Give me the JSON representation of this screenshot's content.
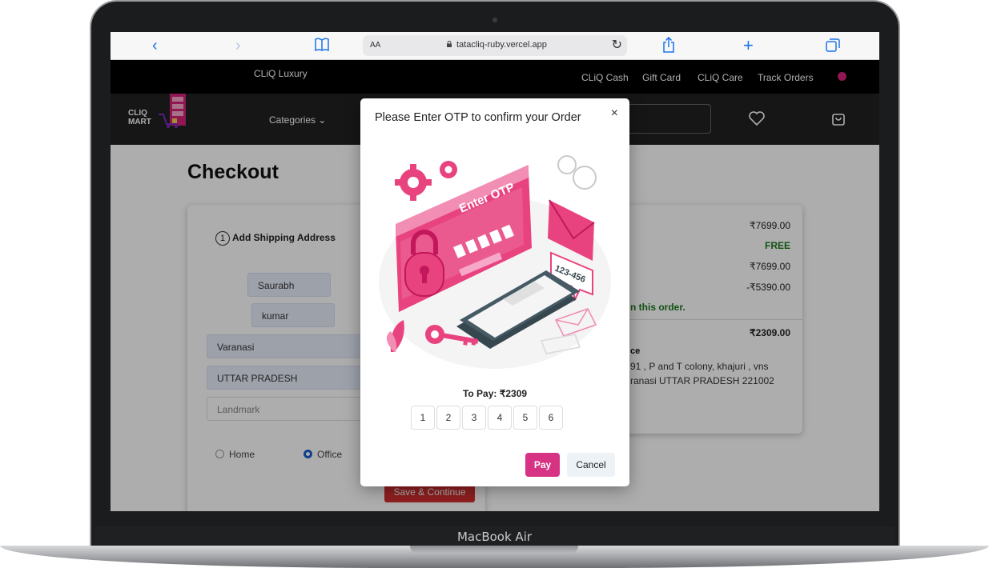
{
  "device": {
    "model_label": "MacBook Air"
  },
  "browser": {
    "aa_label": "AA",
    "url": "tatacliq-ruby.vercel.app",
    "back_icon": "chevron-left-icon",
    "forward_icon": "chevron-right-icon",
    "bookmarks_icon": "book-icon",
    "reload_icon": "reload-icon",
    "share_icon": "share-icon",
    "new_tab_icon": "plus-icon",
    "tabs_icon": "tabs-icon"
  },
  "header": {
    "luxury_label": "CLiQ Luxury",
    "links": [
      "CLiQ Cash",
      "Gift Card",
      "CLiQ Care",
      "Track Orders"
    ],
    "logo_line1": "CLIQ",
    "logo_line2": "MART",
    "categories_label": "Categories ⌄"
  },
  "checkout": {
    "title": "Checkout",
    "step_number": "1",
    "step_label": "Add Shipping Address",
    "fields": {
      "first_name": "Saurabh",
      "last_name": "kumar",
      "city": "Varanasi",
      "state": "UTTAR PRADESH",
      "landmark_placeholder": "Landmark"
    },
    "address_types": [
      "Home",
      "Office"
    ],
    "selected_address_type": "Office",
    "save_button": "Save & Continue"
  },
  "summary": {
    "bag_total": "₹7699.00",
    "shipping": "FREE",
    "subtotal": "₹7699.00",
    "discount": "-₹5390.00",
    "saved_note": "n this order.",
    "total": "₹2309.00",
    "address_title": "ce",
    "address_line1": "91 , P and T colony, khajuri , vns",
    "address_line2": "ranasi UTTAR PRADESH 221002"
  },
  "modal": {
    "title": "Please Enter OTP to confirm your Order",
    "close_label": "×",
    "illustration_text": "Enter OTP",
    "illustration_code": "123-456",
    "to_pay": "To Pay: ₹2309",
    "otp_digits": [
      "1",
      "2",
      "3",
      "4",
      "5",
      "6"
    ],
    "pay_button": "Pay",
    "cancel_button": "Cancel"
  },
  "colors": {
    "accent_pink": "#d63384",
    "save_red": "#d32f2f",
    "free_green": "#1b7a1b",
    "nav_black": "#000000"
  }
}
